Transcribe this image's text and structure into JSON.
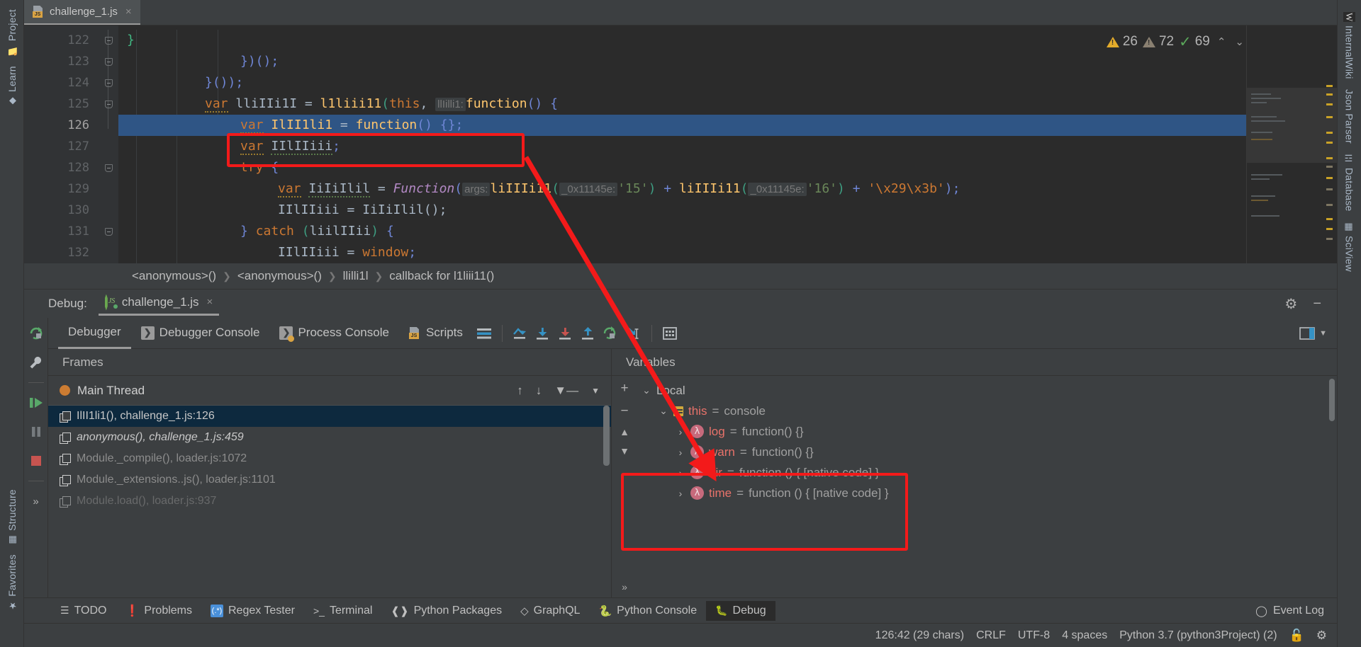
{
  "window": {
    "left_rail": [
      {
        "label": "Project",
        "icon": "folder-icon"
      },
      {
        "label": "Learn",
        "icon": "graduation-cap-icon"
      },
      {
        "label": "Structure",
        "icon": "structure-icon"
      },
      {
        "label": "Favorites",
        "icon": "star-icon"
      }
    ],
    "right_rail": [
      {
        "label": "InternalWiki",
        "icon": "wiki-icon"
      },
      {
        "label": "Json Parser",
        "icon": "json-icon"
      },
      {
        "label": "Database",
        "icon": "database-icon"
      },
      {
        "label": "SciView",
        "icon": "sciview-icon"
      }
    ]
  },
  "editor": {
    "tab": {
      "title": "challenge_1.js",
      "icon": "js-file-icon",
      "close": "×"
    },
    "inspections": {
      "warnings": "26",
      "weak_warnings": "72",
      "checks": "69",
      "up": "⌃",
      "down": "⌄"
    },
    "lines": [
      {
        "num": "122",
        "fold": true
      },
      {
        "num": "123",
        "fold": true
      },
      {
        "num": "124",
        "fold": true
      },
      {
        "num": "125",
        "fold": true
      },
      {
        "num": "126",
        "fold": false,
        "current": true
      },
      {
        "num": "127",
        "fold": false
      },
      {
        "num": "128",
        "fold": true
      },
      {
        "num": "129",
        "fold": false
      },
      {
        "num": "130",
        "fold": false
      },
      {
        "num": "131",
        "fold": true
      },
      {
        "num": "132",
        "fold": false
      }
    ],
    "code": {
      "l122": "}",
      "l123": "})();",
      "l124": "}());",
      "l125_var": "var",
      "l125_name": "lliIIi1I",
      "l125_eq": " = ",
      "l125_call": "l1liii11",
      "l125_this": "this",
      "l125_hint": "llIilli1:",
      "l125_fn": "function",
      "l126_var": "var",
      "l126_name": "IlII1li1",
      "l126_rest": " = function() {};",
      "l127_var": "var",
      "l127_name": "IIlIIiii",
      "l128": "try {",
      "l129_var": "var",
      "l129_name": "IiIiIlil",
      "l129_type": "Function",
      "l129_hint": "args:",
      "l129_call1": "liIIIi11",
      "l129_arg1hint": "_0x11145e:",
      "l129_str1": "'15'",
      "l129_call2": "liIIIi11",
      "l129_arg2hint": "_0x11145e:",
      "l129_str2": "'16'",
      "l129_str3": "'\\x29\\x3b'",
      "l130": "IIlIIiii = IiIiIlil();",
      "l131_catch": "catch",
      "l131_arg": "liilIIii",
      "l132_name": "IIlIIiii",
      "l132_win": "window"
    }
  },
  "breadcrumbs": [
    "<anonymous>()",
    "<anonymous>()",
    "llilli1l",
    "callback for l1liii11()"
  ],
  "debug": {
    "header_label": "Debug:",
    "session_name": "challenge_1.js",
    "session_close": "×",
    "gear": "⚙",
    "minimize": "−",
    "tabs": [
      {
        "label": "Debugger",
        "icon": "debugger-icon",
        "active": true
      },
      {
        "label": "Debugger Console",
        "icon": "console-icon",
        "active": false
      },
      {
        "label": "Process Console",
        "icon": "process-console-icon",
        "active": false
      },
      {
        "label": "Scripts",
        "icon": "js-file-icon",
        "active": false
      }
    ],
    "toolbar_icons": [
      "layout-icon",
      "step-over-icon",
      "step-into-icon",
      "force-step-into-icon",
      "step-out-icon",
      "run-to-cursor-icon",
      "drop-frame-icon",
      "evaluate-expression-icon"
    ],
    "side_icons": [
      "rerun-icon",
      "settings-wrench-icon",
      "resume-icon",
      "pause-icon",
      "stop-icon",
      "more-icon"
    ],
    "frames": {
      "title": "Frames",
      "thread": "Main Thread",
      "controls": [
        "up-arrow-icon",
        "down-arrow-icon",
        "filter-icon",
        "dropdown-icon"
      ],
      "items": [
        {
          "text": "IlII1li1(), challenge_1.js:126",
          "selected": true,
          "italic": false,
          "dim": false
        },
        {
          "text": "anonymous(), challenge_1.js:459",
          "selected": false,
          "italic": true,
          "dim": false
        },
        {
          "text": "Module._compile(), loader.js:1072",
          "selected": false,
          "italic": false,
          "dim": true
        },
        {
          "text": "Module._extensions..js(), loader.js:1101",
          "selected": false,
          "italic": false,
          "dim": true
        },
        {
          "text": "Module.load(), loader.js:937",
          "selected": false,
          "italic": false,
          "dim": true
        }
      ]
    },
    "variables": {
      "title": "Variables",
      "rail_buttons": [
        "+",
        "−",
        "▲",
        "▼",
        "»"
      ],
      "tree": [
        {
          "indent": 0,
          "arrow": "⌄",
          "icon": "none",
          "name": "Local",
          "eq": "",
          "value": ""
        },
        {
          "indent": 1,
          "arrow": "⌄",
          "icon": "object-icon",
          "name": "this",
          "eq": " = ",
          "value": "console"
        },
        {
          "indent": 2,
          "arrow": "›",
          "icon": "lambda-icon",
          "name": "log",
          "eq": " = ",
          "value": "function() {}"
        },
        {
          "indent": 2,
          "arrow": "›",
          "icon": "lambda-icon",
          "name": "warn",
          "eq": " = ",
          "value": "function() {}"
        },
        {
          "indent": 2,
          "arrow": "›",
          "icon": "lambda-icon",
          "name": "dir",
          "eq": " = ",
          "value": "function () { [native code] }"
        },
        {
          "indent": 2,
          "arrow": "›",
          "icon": "lambda-icon",
          "name": "time",
          "eq": " = ",
          "value": "function () { [native code] }"
        }
      ]
    }
  },
  "bottom_tools": [
    {
      "label": "TODO",
      "icon": "todo-icon",
      "active": false
    },
    {
      "label": "Problems",
      "icon": "problems-icon",
      "active": false
    },
    {
      "label": "Regex Tester",
      "icon": "regex-tester-icon",
      "active": false
    },
    {
      "label": "Terminal",
      "icon": "terminal-icon",
      "active": false
    },
    {
      "label": "Python Packages",
      "icon": "python-packages-icon",
      "active": false
    },
    {
      "label": "GraphQL",
      "icon": "graphql-icon",
      "active": false
    },
    {
      "label": "Python Console",
      "icon": "python-console-icon",
      "active": false
    },
    {
      "label": "Debug",
      "icon": "debug-bug-icon",
      "active": true
    }
  ],
  "event_log": {
    "label": "Event Log",
    "icon": "event-log-icon"
  },
  "status": {
    "caret": "126:42 (29 chars)",
    "line_sep": "CRLF",
    "encoding": "UTF-8",
    "indent": "4 spaces",
    "interpreter": "Python 3.7 (python3Project) (2)",
    "lock": "lock-icon",
    "inspection": "inspection-icon"
  },
  "annotations": {
    "color": "#f31a1a",
    "code_highlight_target": "var IlII1li1 = function() {};",
    "variables_highlight_target": "this = console / log / warn"
  }
}
